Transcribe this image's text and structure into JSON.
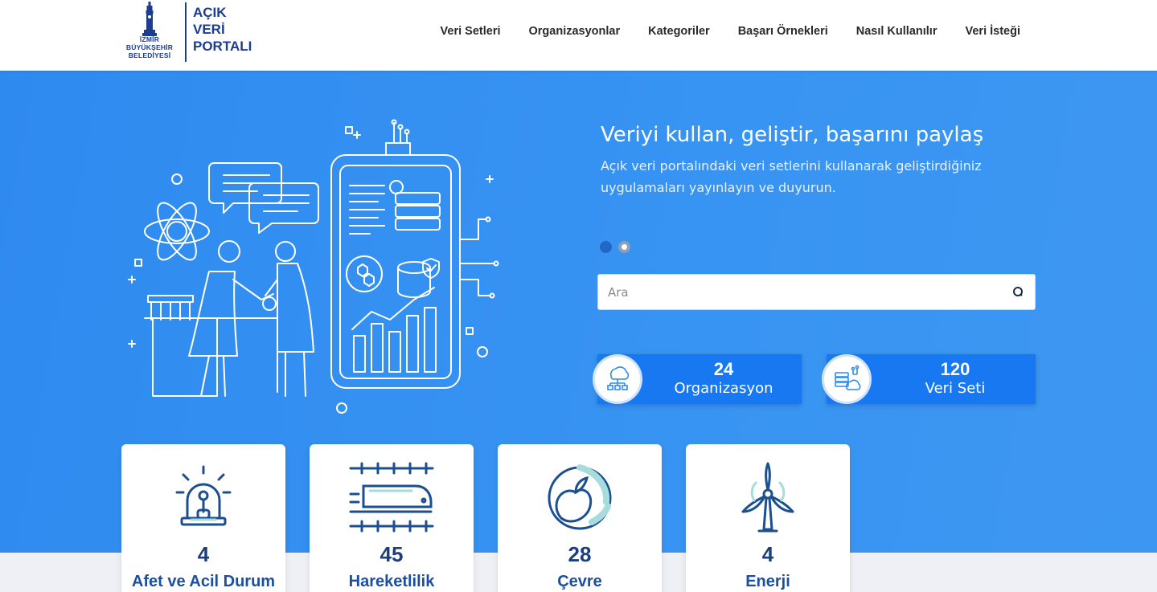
{
  "header": {
    "logo": {
      "city_line1": "İZMİR",
      "city_line2": "BÜYÜKŞEHİR",
      "city_line3": "BELEDİYESİ",
      "title_line1": "AÇIK",
      "title_line2": "VERİ",
      "title_line3": "PORTALI"
    },
    "nav": [
      {
        "label": "Veri Setleri"
      },
      {
        "label": "Organizasyonlar"
      },
      {
        "label": "Kategoriler"
      },
      {
        "label": "Başarı Örnekleri"
      },
      {
        "label": "Nasıl Kullanılır"
      },
      {
        "label": "Veri İsteği"
      }
    ]
  },
  "hero": {
    "title": "Veriyi kullan, geliştir, başarını paylaş",
    "subtitle": "Açık veri portalındaki veri setlerini kullanarak geliştirdiğiniz uygulamaları yayınlayın ve duyurun.",
    "carousel": {
      "active_slide": 1,
      "total_slides": 2
    },
    "search": {
      "placeholder": "Ara",
      "value": ""
    },
    "stats": [
      {
        "count": "24",
        "label": "Organizasyon",
        "icon": "organization-icon"
      },
      {
        "count": "120",
        "label": "Veri Seti",
        "icon": "dataset-icon"
      }
    ]
  },
  "categories": [
    {
      "count": "4",
      "label": "Afet ve Acil Durum",
      "icon": "siren-icon"
    },
    {
      "count": "45",
      "label": "Hareketlilik",
      "icon": "train-icon"
    },
    {
      "count": "28",
      "label": "Çevre",
      "icon": "globe-leaf-icon"
    },
    {
      "count": "4",
      "label": "Enerji",
      "icon": "wind-turbine-icon"
    }
  ],
  "colors": {
    "brand_navy": "#1b3c8f",
    "hero_blue": "#3894f2",
    "stat_blue": "#1778f2",
    "card_text": "#1b4fa0"
  }
}
